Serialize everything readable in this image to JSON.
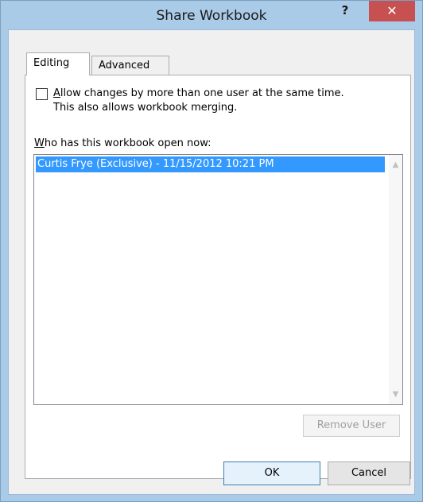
{
  "window": {
    "title": "Share Workbook",
    "help_glyph": "?",
    "close_glyph": "✕"
  },
  "tabs": [
    {
      "label": "Editing",
      "selected": true
    },
    {
      "label": "Advanced",
      "selected": false
    }
  ],
  "editing": {
    "allow_changes": {
      "checked": false,
      "label_line1_prefix": "A",
      "label_line1_rest": "llow changes by more than one user at the same time.",
      "label_line2": "This also allows workbook merging."
    },
    "who_label_prefix": "W",
    "who_label_rest": "ho has this workbook open now:",
    "users": [
      {
        "text": "Curtis Frye (Exclusive) - 11/15/2012 10:21 PM",
        "selected": true
      }
    ],
    "remove_user_label": "Remove User"
  },
  "footer": {
    "ok_label": "OK",
    "cancel_label": "Cancel"
  },
  "colors": {
    "title_bar": "#aacbe8",
    "close_button": "#c75050",
    "selection": "#3399ff"
  },
  "icons": {
    "scroll_up": "chevron-up-icon",
    "scroll_down": "chevron-down-icon"
  }
}
